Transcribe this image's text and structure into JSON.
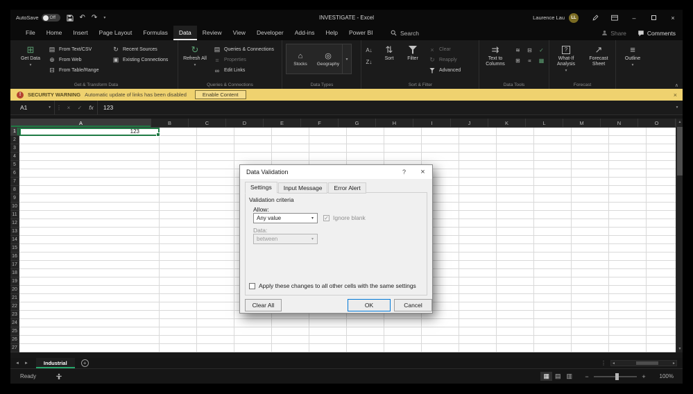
{
  "titlebar": {
    "autosave_label": "AutoSave",
    "autosave_state": "Off",
    "title": "INVESTIGATE  -  Excel",
    "user_name": "Laurence Lau",
    "user_initials": "LL"
  },
  "tabs": {
    "items": [
      "File",
      "Home",
      "Insert",
      "Page Layout",
      "Formulas",
      "Data",
      "Review",
      "View",
      "Developer",
      "Add-ins",
      "Help",
      "Power BI"
    ],
    "active": "Data",
    "search": "Search",
    "share": "Share",
    "comments": "Comments"
  },
  "ribbon": {
    "get_transform": {
      "label": "Get & Transform Data",
      "get_data": "Get Data",
      "from_text": "From Text/CSV",
      "from_web": "From Web",
      "from_table": "From Table/Range",
      "recent": "Recent Sources",
      "existing": "Existing Connections"
    },
    "queries": {
      "label": "Queries & Connections",
      "refresh": "Refresh All",
      "qc": "Queries & Connections",
      "properties": "Properties",
      "edit_links": "Edit Links"
    },
    "data_types": {
      "label": "Data Types",
      "stocks": "Stocks",
      "geography": "Geography"
    },
    "sort_filter": {
      "label": "Sort & Filter",
      "sort": "Sort",
      "filter": "Filter",
      "clear": "Clear",
      "reapply": "Reapply",
      "advanced": "Advanced"
    },
    "data_tools": {
      "label": "Data Tools",
      "text_to_columns": "Text to Columns"
    },
    "forecast": {
      "label": "Forecast",
      "what_if": "What-If Analysis",
      "forecast_sheet": "Forecast Sheet"
    },
    "outline": {
      "label": "Outline"
    }
  },
  "ribbon_icons": {
    "get_data": "⊞",
    "from_text": "▤",
    "from_web": "⊕",
    "from_table": "⊟",
    "recent": "↻",
    "existing": "▣",
    "refresh": "↻",
    "qc": "▤",
    "properties": "≡",
    "edit_links": "∞",
    "stocks": "⌂",
    "geography": "◎",
    "sort_az": "A↓",
    "sort_za": "Z↓",
    "sort": "⇅",
    "clear": "×",
    "reapply": "↻",
    "text_to_columns": "⇉",
    "flash_fill": "≋",
    "remove_dup": "⊟",
    "validation": "✓",
    "consolidate": "⊞",
    "relationships": "∝",
    "data_model": "▦",
    "what_if": "?",
    "forecast_sheet": "↗",
    "outline": "≡"
  },
  "icons": {
    "chevron_down": "▾",
    "undo": "↶",
    "redo": "↷",
    "more_v": "⋮",
    "close": "×",
    "minimize": "–",
    "check": "✓",
    "cancel_x": "×",
    "help": "?",
    "collapse": "∧",
    "scroll_left": "◄",
    "scroll_right": "►",
    "scroll_up": "▲",
    "scroll_down": "▼",
    "plus": "+",
    "minus": "−",
    "warning": "!",
    "view_normal": "▦",
    "view_layout": "▤",
    "view_break": "▥"
  },
  "security": {
    "badge": "SECURITY WARNING",
    "message": "Automatic update of links has been disabled",
    "action": "Enable Content"
  },
  "formula_bar": {
    "name_box": "A1",
    "fx": "fx",
    "value": "123"
  },
  "grid": {
    "columns": [
      "A",
      "B",
      "C",
      "D",
      "E",
      "F",
      "G",
      "H",
      "I",
      "J",
      "K",
      "L",
      "M",
      "N",
      "O"
    ],
    "row_count": 27,
    "a1_value": "123"
  },
  "dialog": {
    "title": "Data Validation",
    "tabs": [
      "Settings",
      "Input Message",
      "Error Alert"
    ],
    "active_tab": "Settings",
    "section": "Validation criteria",
    "allow_label": "Allow:",
    "allow_value": "Any value",
    "ignore_blank": "Ignore blank",
    "data_label": "Data:",
    "data_value": "between",
    "apply": "Apply these changes to all other cells with the same settings",
    "clear_all": "Clear All",
    "ok": "OK",
    "cancel": "Cancel"
  },
  "sheet_bar": {
    "tab": "Industrial"
  },
  "status_bar": {
    "ready": "Ready",
    "zoom": "100%"
  },
  "colors": {
    "accent_green": "#1f7a44",
    "warning_bar": "#efd26f",
    "default_button_border": "#0078d7"
  }
}
